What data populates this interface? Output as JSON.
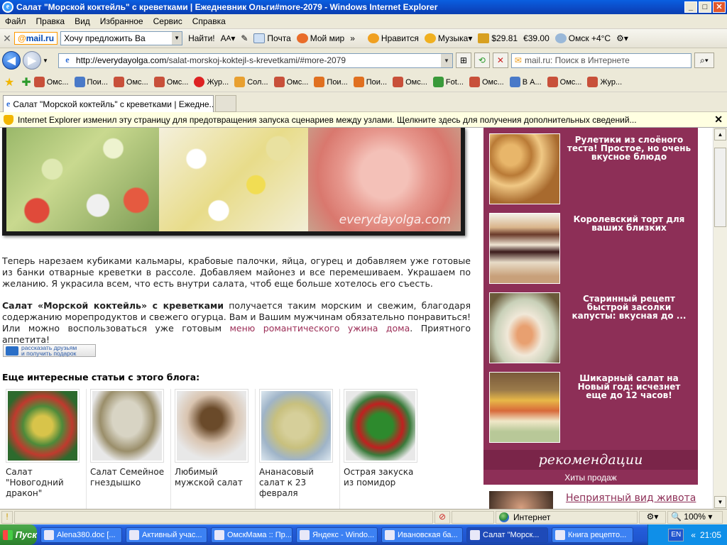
{
  "window": {
    "title": "Салат \"Морской коктейль\" с креветками | Ежедневник Ольги#more-2079 - Windows Internet Explorer",
    "btn_min": "_",
    "btn_max": "□",
    "btn_close": "✕"
  },
  "menu": [
    "Файл",
    "Правка",
    "Вид",
    "Избранное",
    "Сервис",
    "Справка"
  ],
  "mailbar": {
    "logo_at": "@",
    "logo_text": "mail.ru",
    "search_value": "Хочу предложить Ва",
    "find_label": "Найти!",
    "items": [
      "Почта",
      "Мой мир"
    ],
    "more_label": "»",
    "right_items": [
      "Нравится",
      "Музыка",
      "29.81",
      "39.00",
      "Омск +4°C"
    ]
  },
  "address": {
    "url_host": "http://everydayolga.com",
    "url_path": "/salat-morskoj-koktejl-s-krevetkami/#more-2079",
    "search_placeholder": "mail.ru: Поиск в Интернете"
  },
  "links": [
    "Омс...",
    "Пои...",
    "Омс...",
    "Омс...",
    "Жур...",
    "Сол...",
    "Омс...",
    "Пои...",
    "Пои...",
    "Омс...",
    "Fot...",
    "Омс...",
    "В А...",
    "Омс...",
    "Жур..."
  ],
  "tab": {
    "label": "Салат \"Морской коктейль\" с креветками | Ежедне..."
  },
  "infobar": {
    "text": "Internet Explorer изменил эту страницу для предотвращения запуска сценариев между узлами. Щелкните здесь для получения дополнительных сведений..."
  },
  "page": {
    "watermark": "everydayolga.com",
    "para1": "Теперь нарезаем кубиками кальмары, крабовые палочки, яйца, огурец и добавляем уже готовые из банки отварные креветки в рассоле. Добавляем майонез и все перемешиваем. Украшаем по желанию. Я украсила всем, что есть внутри салата, чтоб еще больше хотелось его съесть.",
    "para2_bold": "Салат «Морской коктейль» с креветками",
    "para2_text": " получается таким морским и свежим, благодаря содержанию морепродуктов и свежего огурца. Вам и Вашим мужчинам обязательно понравиться! Или можно воспользоваться уже готовым ",
    "para2_link": "меню романтического ужина дома",
    "para2_end": ". Приятного аппетита!",
    "share_line1": "рассказать друзьям",
    "share_line2": "и получить подарок",
    "more_heading": "Еще интересные статьи с этого блога:",
    "related": [
      "Салат \"Новогодний дракон\"",
      "Салат Семейное гнездышко",
      "Любимый мужской салат",
      "Ананасовый салат к 23 февраля",
      "Острая закуска из помидор"
    ]
  },
  "sidebar": {
    "items": [
      "Рулетики из слоёного теста! Простое, но очень вкусное блюдо",
      "Королевский торт для ваших близких",
      "Старинный рецепт быстрой засолки капусты: вкусная до ...",
      "Шикарный салат на Новый год: исчезнет еще до 12 часов!"
    ],
    "recommend_title": "рекомендации",
    "hits_title": "Хиты продаж",
    "rec_item": "Неприятный вид живота"
  },
  "status": {
    "zone": "Интернет",
    "zoom": "100%"
  },
  "taskbar": {
    "start": "Пуск",
    "tasks": [
      "Alena380.doc [...",
      "Активный учас...",
      "ОмскМама :: Пр...",
      "Яндекс - Windo...",
      "Ивановская ба...",
      "Салат \"Морск...",
      "Книга рецепто..."
    ],
    "lang": "EN",
    "clock": "21:05"
  }
}
